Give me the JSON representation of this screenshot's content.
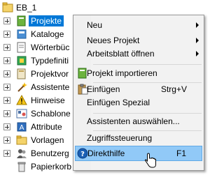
{
  "tree": {
    "root_label": "EB_1",
    "items": [
      {
        "label": "Projekte",
        "icon": "projects-icon",
        "selected": true
      },
      {
        "label": "Kataloge",
        "icon": "catalog-icon"
      },
      {
        "label": "Wörterbüc",
        "icon": "dictionary-icon"
      },
      {
        "label": "Typdefiniti",
        "icon": "type-definitions-icon"
      },
      {
        "label": "Projektvor",
        "icon": "project-templates-icon"
      },
      {
        "label": "Assistente",
        "icon": "wizard-icon"
      },
      {
        "label": "Hinweise",
        "icon": "hints-icon"
      },
      {
        "label": "Schablone",
        "icon": "stencils-icon"
      },
      {
        "label": "Attribute",
        "icon": "attributes-icon"
      },
      {
        "label": "Vorlagen",
        "icon": "templates-folder-icon"
      },
      {
        "label": "Benutzerg",
        "icon": "user-groups-icon"
      },
      {
        "label": "Papierkorb",
        "icon": "recycle-bin-icon"
      }
    ]
  },
  "context_menu": {
    "new": "Neu",
    "new_project": "Neues Projekt",
    "open_worksheet": "Arbeitsblatt öffnen",
    "import_project": "Projekt importieren",
    "paste": "Einfügen",
    "paste_shortcut": "Strg+V",
    "paste_special": "Einfügen Spezial",
    "select_wizards": "Assistenten auswählen...",
    "access_control": "Zugriffssteuerung",
    "direct_help": "Direkthilfe",
    "direct_help_shortcut": "F1"
  },
  "colors": {
    "selection": "#0078d7",
    "menu_highlight": "#91c9f7"
  }
}
